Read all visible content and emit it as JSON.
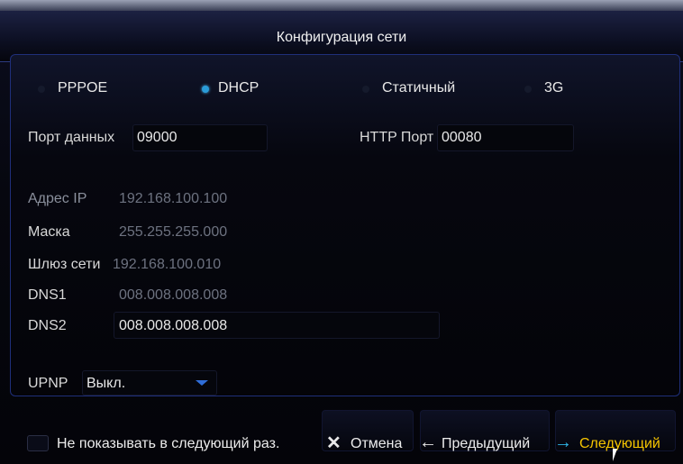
{
  "window": {
    "title": "Конфигурация сети"
  },
  "network_type": {
    "options": [
      {
        "label": "PPPOE",
        "selected": false
      },
      {
        "label": "DHCP",
        "selected": true
      },
      {
        "label": "Статичный",
        "selected": false
      },
      {
        "label": "3G",
        "selected": false
      }
    ]
  },
  "ports": {
    "data_label": "Порт данных",
    "data_value": "09000",
    "http_label": "HTTP Порт",
    "http_value": "00080"
  },
  "ip": {
    "address_label": "Адрес IP",
    "address_value": "192.168.100.100",
    "mask_label": "Маска",
    "mask_value": "255.255.255.000",
    "gateway_label": "Шлюз сети",
    "gateway_value": "192.168.100.010",
    "dns1_label": "DNS1",
    "dns1_value": "008.008.008.008",
    "dns2_label": "DNS2",
    "dns2_value": "008.008.008.008"
  },
  "upnp": {
    "label": "UPNP",
    "value": "Выкл."
  },
  "footer": {
    "dont_show_label": "Не показывать в следующий раз.",
    "cancel_label": "Отмена",
    "prev_label": "Предыдущий",
    "next_label": "Следующий"
  },
  "colors": {
    "accent": "#2a9cd8",
    "next": "#f5c400",
    "next_arrow": "#2fb7e8"
  }
}
